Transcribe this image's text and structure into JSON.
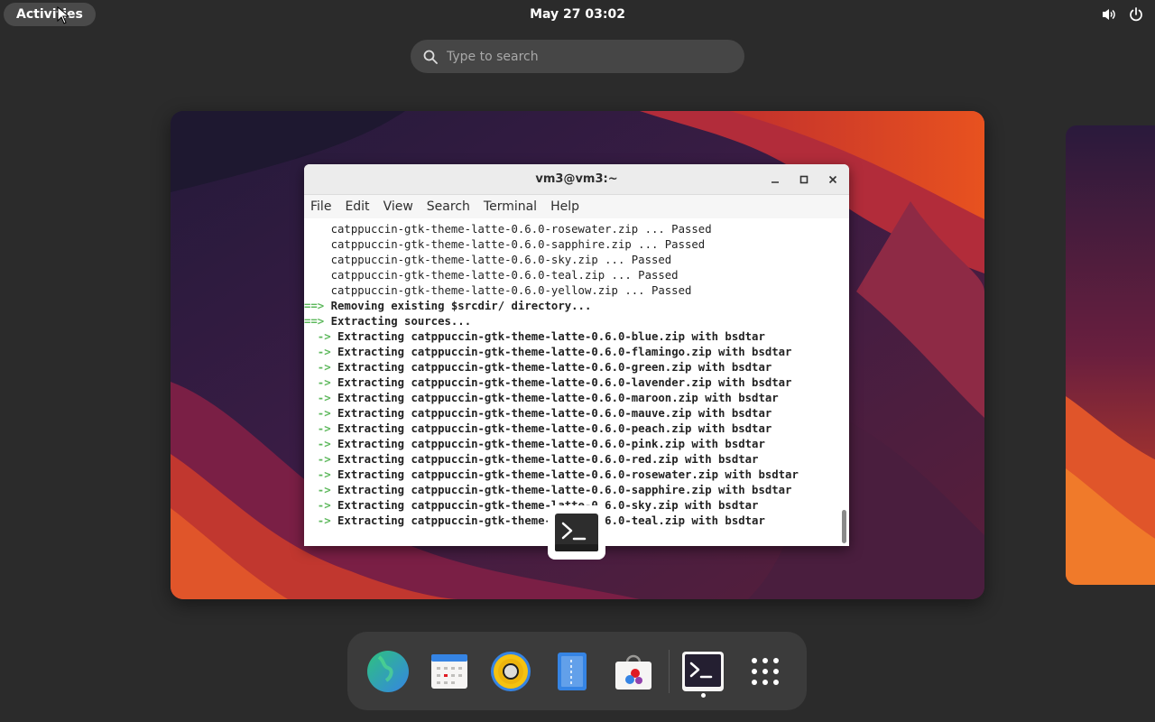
{
  "topbar": {
    "activities_label": "Activities",
    "clock": "May 27  03:02",
    "tray_icons": [
      "volume-icon",
      "power-icon"
    ]
  },
  "search": {
    "placeholder": "Type to search"
  },
  "terminal": {
    "title": "vm3@vm3:~",
    "menu": [
      "File",
      "Edit",
      "View",
      "Search",
      "Terminal",
      "Help"
    ],
    "lines": [
      {
        "prefix": "",
        "text": "    catppuccin-gtk-theme-latte-0.6.0-rosewater.zip ... Passed",
        "bold": false
      },
      {
        "prefix": "",
        "text": "    catppuccin-gtk-theme-latte-0.6.0-sapphire.zip ... Passed",
        "bold": false
      },
      {
        "prefix": "",
        "text": "    catppuccin-gtk-theme-latte-0.6.0-sky.zip ... Passed",
        "bold": false
      },
      {
        "prefix": "",
        "text": "    catppuccin-gtk-theme-latte-0.6.0-teal.zip ... Passed",
        "bold": false
      },
      {
        "prefix": "",
        "text": "    catppuccin-gtk-theme-latte-0.6.0-yellow.zip ... Passed",
        "bold": false
      },
      {
        "prefix": "==>",
        "text": " Removing existing $srcdir/ directory...",
        "bold": true
      },
      {
        "prefix": "==>",
        "text": " Extracting sources...",
        "bold": true
      },
      {
        "prefix": "  ->",
        "text": " Extracting catppuccin-gtk-theme-latte-0.6.0-blue.zip with bsdtar",
        "bold": true
      },
      {
        "prefix": "  ->",
        "text": " Extracting catppuccin-gtk-theme-latte-0.6.0-flamingo.zip with bsdtar",
        "bold": true
      },
      {
        "prefix": "  ->",
        "text": " Extracting catppuccin-gtk-theme-latte-0.6.0-green.zip with bsdtar",
        "bold": true
      },
      {
        "prefix": "  ->",
        "text": " Extracting catppuccin-gtk-theme-latte-0.6.0-lavender.zip with bsdtar",
        "bold": true
      },
      {
        "prefix": "  ->",
        "text": " Extracting catppuccin-gtk-theme-latte-0.6.0-maroon.zip with bsdtar",
        "bold": true
      },
      {
        "prefix": "  ->",
        "text": " Extracting catppuccin-gtk-theme-latte-0.6.0-mauve.zip with bsdtar",
        "bold": true
      },
      {
        "prefix": "  ->",
        "text": " Extracting catppuccin-gtk-theme-latte-0.6.0-peach.zip with bsdtar",
        "bold": true
      },
      {
        "prefix": "  ->",
        "text": " Extracting catppuccin-gtk-theme-latte-0.6.0-pink.zip with bsdtar",
        "bold": true
      },
      {
        "prefix": "  ->",
        "text": " Extracting catppuccin-gtk-theme-latte-0.6.0-red.zip with bsdtar",
        "bold": true
      },
      {
        "prefix": "  ->",
        "text": " Extracting catppuccin-gtk-theme-latte-0.6.0-rosewater.zip with bsdtar",
        "bold": true
      },
      {
        "prefix": "  ->",
        "text": " Extracting catppuccin-gtk-theme-latte-0.6.0-sapphire.zip with bsdtar",
        "bold": true
      },
      {
        "prefix": "  ->",
        "text": " Extracting catppuccin-gtk-theme-latte-0.6.0-sky.zip with bsdtar",
        "bold": true
      },
      {
        "prefix": "  ->",
        "text": " Extracting catppuccin-gtk-theme-latte-0.6.0-teal.zip with bsdtar",
        "bold": true
      }
    ],
    "arrow_color": "#5db85c"
  },
  "dock": {
    "items": [
      "web-browser-icon",
      "calendar-icon",
      "music-player-icon",
      "text-editor-icon",
      "software-store-icon",
      "terminal-icon",
      "app-grid-icon"
    ],
    "running": "terminal-icon"
  },
  "colors": {
    "panel": "#2b2b2b",
    "accent": "#3584e4"
  }
}
